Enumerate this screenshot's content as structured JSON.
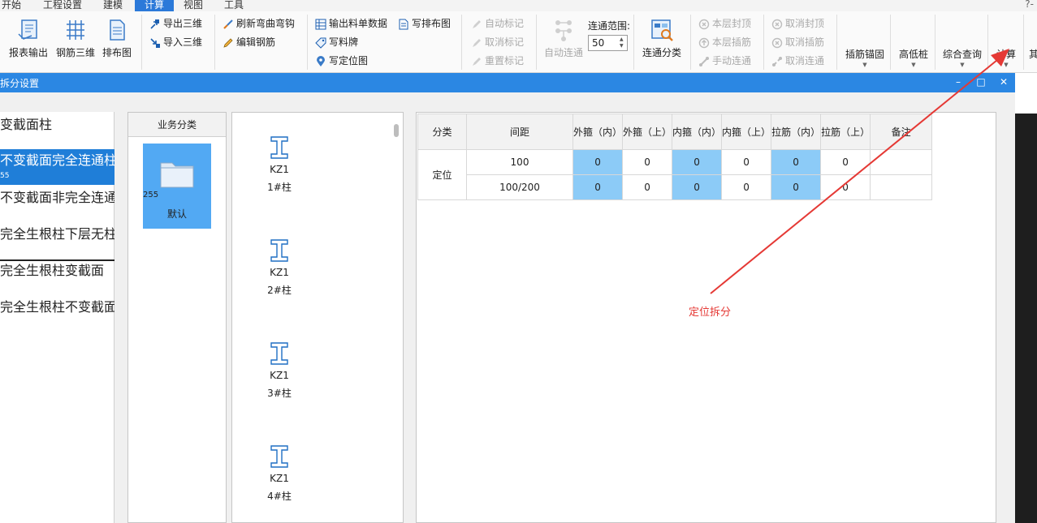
{
  "menu": {
    "items": [
      "开始",
      "工程设置",
      "建模",
      "计算",
      "视图",
      "工具"
    ],
    "active": "计算",
    "help": "?-"
  },
  "ribbon": {
    "report_output": "报表输出",
    "rebar_3d": "钢筋三维",
    "layout_drawing": "排布图",
    "export_3d": "导出三维",
    "import_3d": "导入三维",
    "refresh_bend_hook": "刷新弯曲弯钩",
    "edit_rebar": "编辑钢筋",
    "output_material_data": "输出料单数据",
    "write_tag": "写料牌",
    "write_position_drawing": "写定位图",
    "write_layout_drawing": "写排布图",
    "auto_mark": "自动标记",
    "cancel_mark": "取消标记",
    "reset_mark": "重置标记",
    "auto_connect": "自动连通",
    "connect_range_label": "连通范围:",
    "connect_range_value": "50",
    "connect_classify": "连通分类",
    "layer_top_seal": "本层封顶",
    "layer_insert_rebar": "本层插筋",
    "manual_connect": "手动连通",
    "cancel_top_seal": "取消封顶",
    "cancel_insert_rebar": "取消插筋",
    "cancel_connect": "取消连通",
    "insert_anchor": "插筋锚固",
    "high_low_pile": "高低桩",
    "comprehensive_query": "综合查询",
    "calculate": "计算",
    "cut_label": "其"
  },
  "dialog": {
    "title": "拆分设置",
    "min": "–",
    "max": "□",
    "close": "✕"
  },
  "left_list": {
    "items": [
      {
        "label": "变截面柱",
        "sub": ""
      },
      {
        "label": "不变截面完全连通柱",
        "sub": "55"
      },
      {
        "label": "不变截面非完全连通",
        "sub": ""
      },
      {
        "label": "完全生根柱下层无柱",
        "sub": ""
      },
      {
        "label": "完全生根柱变截面",
        "sub": ""
      },
      {
        "label": "完全生根柱不变截面",
        "sub": ""
      }
    ]
  },
  "category": {
    "header": "业务分类",
    "tile_label": "默认",
    "tile_count": "255"
  },
  "columns": [
    {
      "code": "KZ1",
      "name": "1#柱"
    },
    {
      "code": "KZ1",
      "name": "2#柱"
    },
    {
      "code": "KZ1",
      "name": "3#柱"
    },
    {
      "code": "KZ1",
      "name": "4#柱"
    }
  ],
  "table": {
    "headers": [
      "分类",
      "间距",
      "外箍（内）",
      "外箍（上）",
      "内箍（内）",
      "内箍（上）",
      "拉筋（内）",
      "拉筋（上）",
      "备注"
    ],
    "group_label": "定位",
    "rows": [
      {
        "spacing": "100",
        "values": [
          "0",
          "0",
          "0",
          "0",
          "0",
          "0"
        ],
        "note": ""
      },
      {
        "spacing": "100/200",
        "values": [
          "0",
          "0",
          "0",
          "0",
          "0",
          "0"
        ],
        "note": ""
      }
    ]
  },
  "annotation": {
    "label": "定位拆分",
    "color": "#e53935"
  },
  "colors": {
    "accent": "#2b87e3",
    "selected": "#1f7ed8",
    "tile": "#52a9f3",
    "cell_highlight": "#8ccbf7"
  }
}
